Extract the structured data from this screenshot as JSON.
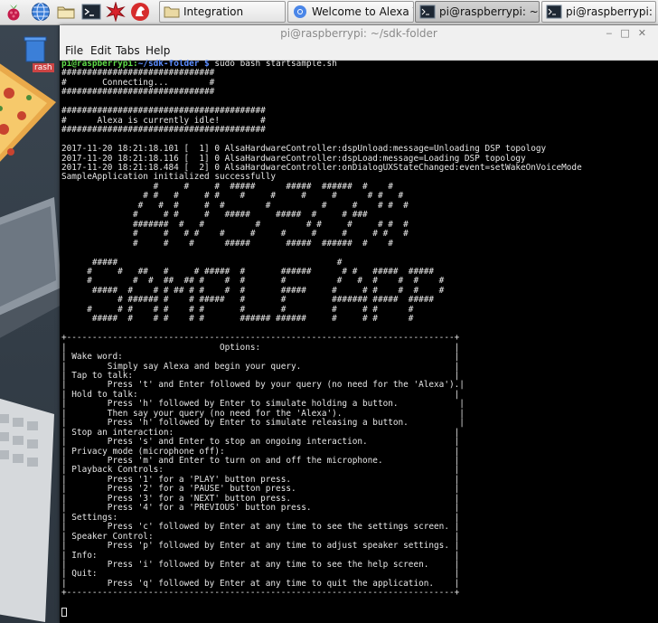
{
  "taskbar": {
    "launchers": [
      {
        "name": "raspberry-menu-icon"
      },
      {
        "name": "web-browser-icon"
      },
      {
        "name": "file-manager-icon"
      },
      {
        "name": "terminal-icon"
      },
      {
        "name": "mathematica-icon"
      },
      {
        "name": "wolfram-icon"
      }
    ],
    "tasks": [
      {
        "label": "Integration",
        "icon": "folder-icon"
      },
      {
        "label": "Welcome to Alexa Voi",
        "icon": "chromium-icon"
      },
      {
        "label": "pi@raspberrypi: ~/sd",
        "icon": "terminal-icon"
      },
      {
        "label": "pi@raspberrypi: ~",
        "icon": "terminal-icon"
      }
    ]
  },
  "desktop": {
    "trash_label": "rash"
  },
  "terminal": {
    "title": "pi@raspberrypi: ~/sdk-folder",
    "menu": [
      "File",
      "Edit",
      "Tabs",
      "Help"
    ],
    "prompt_user": "pi@raspberrypi",
    "prompt_path": "~/sdk-folder $",
    "command": "sudo bash startsample.sh",
    "output": [
      "##############################",
      "#       Connecting...        #",
      "##############################",
      "",
      "########################################",
      "#      Alexa is currently idle!        #",
      "########################################",
      "",
      "2017-11-20 18:21:18.101 [  1] 0 AlsaHardwareController:dspUnload:message=Unloading DSP topology",
      "2017-11-20 18:21:18.116 [  1] 0 AlsaHardwareController:dspLoad:message=Loading DSP topology",
      "2017-11-20 18:21:18.484 [  2] 0 AlsaHardwareController:onDialogUXStateChanged:event=setWakeOnVoiceMode",
      "SampleApplication initialized successfully",
      "                  #     #     #  #####      #####  ######  #    #",
      "                # #   #     # #    #     #     #     #      # #   #",
      "               #   #  #     #  #        #          #     #    # #  #",
      "              #     # #     #   #####     #####  #     # ###",
      "              #######  #   #          #         # #     #     # #  #",
      "              #     #   # #    #     #     #     #     #     # #   #",
      "              #     #    #      #####       #####  ######  #    #",
      "",
      "      #####                                           #",
      "     #     #   ##   #     # #####  #       ######      # #   #####  #####",
      "     #        #  #  ##  ## #    #  #       #          #   #  #    #  #    #",
      "      #####  #    # # ## # #    #  #       #####     #     # #    #  #    #",
      "           # ###### #    # #####   #       #         ####### #####  #####",
      "     #     # #    # #    # #       #       #         #     # #      #",
      "      #####  #    # #    # #       ###### ######     #     # #      #",
      "",
      "+----------------------------------------------------------------------------+",
      "|                              Options:                                      |",
      "| Wake word:                                                                 |",
      "|        Simply say Alexa and begin your query.                              |",
      "| Tap to talk:                                                               |",
      "|        Press 't' and Enter followed by your query (no need for the 'Alexa').|",
      "| Hold to talk:                                                              |",
      "|        Press 'h' followed by Enter to simulate holding a button.            |",
      "|        Then say your query (no need for the 'Alexa').                       |",
      "|        Press 'h' followed by Enter to simulate releasing a button.          |",
      "| Stop an interaction:                                                       |",
      "|        Press 's' and Enter to stop an ongoing interaction.                 |",
      "| Privacy mode (microphone off):                                             |",
      "|        Press 'm' and Enter to turn on and off the microphone.              |",
      "| Playback Controls:                                                         |",
      "|        Press '1' for a 'PLAY' button press.                                |",
      "|        Press '2' for a 'PAUSE' button press.                               |",
      "|        Press '3' for a 'NEXT' button press.                                |",
      "|        Press '4' for a 'PREVIOUS' button press.                            |",
      "| Settings:                                                                  |",
      "|        Press 'c' followed by Enter at any time to see the settings screen. |",
      "| Speaker Control:                                                           |",
      "|        Press 'p' followed by Enter at any time to adjust speaker settings. |",
      "| Info:                                                                      |",
      "|        Press 'i' followed by Enter at any time to see the help screen.     |",
      "| Quit:                                                                      |",
      "|        Press 'q' followed by Enter at any time to quit the application.    |",
      "+----------------------------------------------------------------------------+",
      ""
    ]
  }
}
